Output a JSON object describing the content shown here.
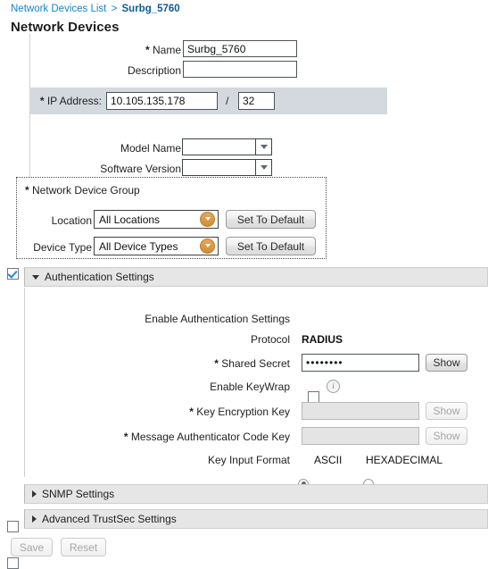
{
  "breadcrumb": {
    "parent": "Network Devices List",
    "separator": ">",
    "current": "Surbg_5760"
  },
  "page_title": "Network Devices",
  "form": {
    "name": {
      "label": "Name",
      "required_mark": "*",
      "value": "Surbg_5760"
    },
    "description": {
      "label": "Description",
      "value": "",
      "placeholder": ""
    },
    "ip_address": {
      "label": "IP Address:",
      "required_mark": "*",
      "value": "10.105.135.178",
      "slash": "/",
      "mask": "32"
    },
    "model_name": {
      "label": "Model Name",
      "value": ""
    },
    "software_version": {
      "label": "Software Version",
      "value": ""
    }
  },
  "network_device_group": {
    "legend": "Network Device Group",
    "required_mark": "*",
    "location": {
      "label": "Location",
      "value": "All Locations",
      "button": "Set To Default"
    },
    "device_type": {
      "label": "Device Type",
      "value": "All Device Types",
      "button": "Set To Default"
    }
  },
  "authentication_settings": {
    "panel_title": "Authentication Settings",
    "enabled": true,
    "expanded": true,
    "enable_label": "Enable Authentication Settings",
    "protocol": {
      "label": "Protocol",
      "value": "RADIUS"
    },
    "shared_secret": {
      "label": "Shared Secret",
      "required_mark": "*",
      "value": "••••••••",
      "show_button": "Show"
    },
    "enable_keywrap": {
      "label": "Enable KeyWrap",
      "checked": false,
      "info": "i"
    },
    "key_encryption_key": {
      "label": "Key Encryption Key",
      "required_mark": "*",
      "value": "",
      "show_button": "Show",
      "disabled": true
    },
    "message_authenticator_code_key": {
      "label": "Message Authenticator Code Key",
      "required_mark": "*",
      "value": "",
      "show_button": "Show",
      "disabled": true
    },
    "key_input_format": {
      "label": "Key Input Format",
      "options": [
        "ASCII",
        "HEXADECIMAL"
      ],
      "selected": "ASCII"
    }
  },
  "snmp_settings": {
    "panel_title": "SNMP Settings",
    "enabled": false,
    "expanded": false
  },
  "advanced_trustsec_settings": {
    "panel_title": "Advanced TrustSec Settings",
    "enabled": false,
    "expanded": false
  },
  "footer": {
    "save": "Save",
    "reset": "Reset"
  },
  "colors": {
    "link": "#1386c8",
    "link_current": "#0c5d93",
    "ip_band": "#d3d9de",
    "panel_header": "#e6e6e6",
    "ndg_dropdown": "#d08e36",
    "checkbox_check": "#2f82d0"
  }
}
